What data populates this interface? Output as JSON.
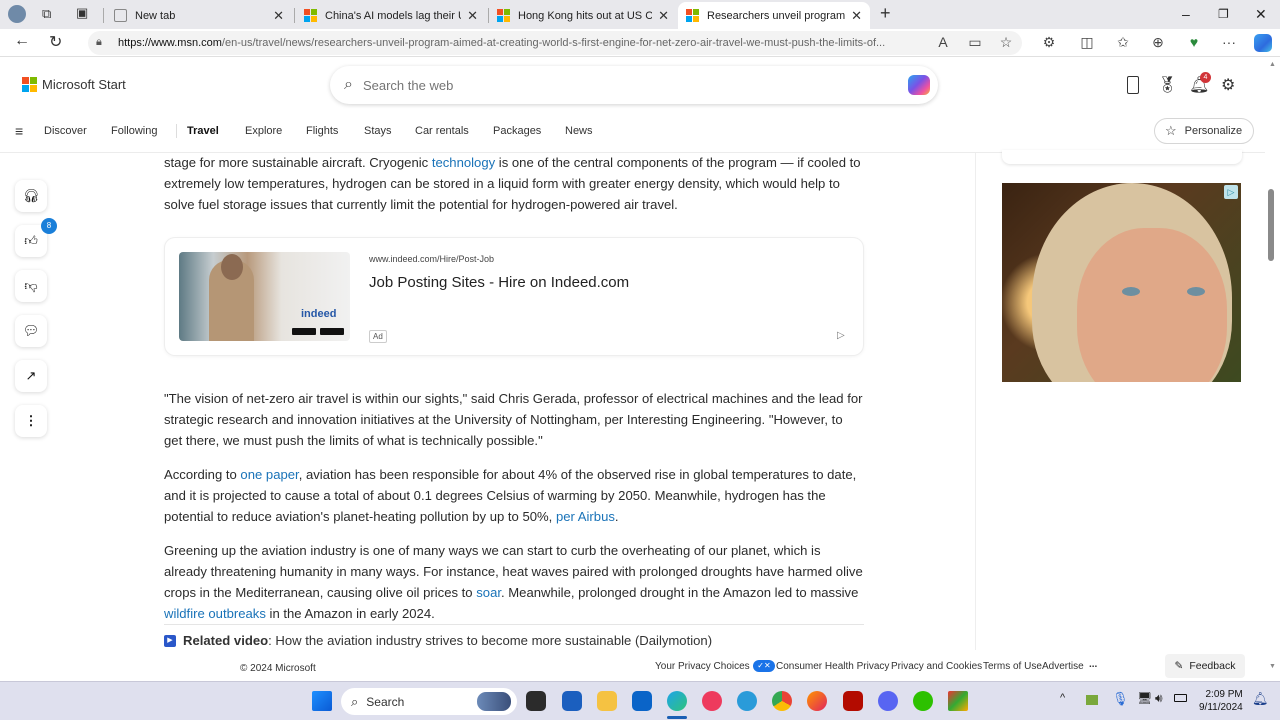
{
  "browser": {
    "tabs": [
      {
        "title": "New tab",
        "icon": "new-tab-icon",
        "active": false
      },
      {
        "title": "China's AI models lag their U.S. co",
        "icon": "msn-icon",
        "active": false
      },
      {
        "title": "Hong Kong hits out at US Congre",
        "icon": "msn-icon",
        "active": false
      },
      {
        "title": "Researchers unveil program aime",
        "icon": "msn-icon",
        "active": true
      }
    ],
    "new_tab_label": "+",
    "window_controls": {
      "minimize": "–",
      "restore": "❐",
      "close": "✕"
    },
    "url_domain": "https://www.msn.com",
    "url_path": "/en-us/travel/news/researchers-unveil-program-aimed-at-creating-world-s-first-engine-for-net-zero-air-travel-we-must-push-the-limits-of..."
  },
  "msn": {
    "logo_text": "Microsoft Start",
    "search_placeholder": "Search the web",
    "notification_count": "4",
    "nav": [
      "Discover",
      "Following",
      "Travel",
      "Explore",
      "Flights",
      "Stays",
      "Car rentals",
      "Packages",
      "News"
    ],
    "nav_active": "Travel",
    "personalize_label": "Personalize",
    "like_count": "8"
  },
  "article": {
    "p1": {
      "before": "stage for more sustainable aircraft. Cryogenic ",
      "link": "technology",
      "after": " is one of the central components of the program — if cooled to extremely low temperatures, hydrogen can be stored in a liquid form with greater energy density, which would help to solve fuel storage issues that currently limit the potential for hydrogen-powered air travel."
    },
    "ad": {
      "url": "www.indeed.com/Hire/Post-Job",
      "title": "Job Posting Sites - Hire on Indeed.com",
      "brand": "indeed",
      "label": "Ad",
      "choice_icon": "▷"
    },
    "p2": "\"The vision of net-zero air travel is within our sights,\" said Chris Gerada, professor of electrical machines and the lead for strategic research and innovation initiatives at the University of Nottingham, per Interesting Engineering. \"However, to get there, we must push the limits of what is technically possible.\"",
    "p3": {
      "t1": "According to ",
      "link1": "one paper",
      "t2": ", aviation has been responsible for about 4% of the observed rise in global temperatures to date, and it is projected to cause a total of about 0.1 degrees Celsius of warming by 2050. Meanwhile, hydrogen has the potential to reduce aviation's planet-heating pollution by up to 50%, ",
      "link2": "per Airbus",
      "t3": "."
    },
    "p4": {
      "t1": "Greening up the aviation industry is one of many ways we can start to curb the overheating of our planet, which is already threatening humanity in many ways. For instance, heat waves paired with prolonged droughts have harmed olive crops in the Mediterranean, causing olive oil prices to ",
      "link1": "soar",
      "t2": ". Meanwhile, prolonged drought in the Amazon led to massive ",
      "link2": "wildfire outbreaks",
      "t3": " in the Amazon in early 2024."
    },
    "related_label": "Related video",
    "related_text": ": How the aviation industry strives to become more sustainable (Dailymotion)"
  },
  "footer": {
    "copyright": "© 2024 Microsoft",
    "links": [
      "Your Privacy Choices",
      "Consumer Health Privacy",
      "Privacy and Cookies",
      "Terms of Use",
      "Advertise"
    ],
    "more": "...",
    "feedback": "Feedback"
  },
  "taskbar": {
    "search_label": "Search",
    "time": "2:09 PM",
    "date": "9/11/2024",
    "tray_chevron": "^"
  },
  "colors": {
    "link": "#1a73b8",
    "accent": "#1a7fd9",
    "notification": "#d13438"
  }
}
